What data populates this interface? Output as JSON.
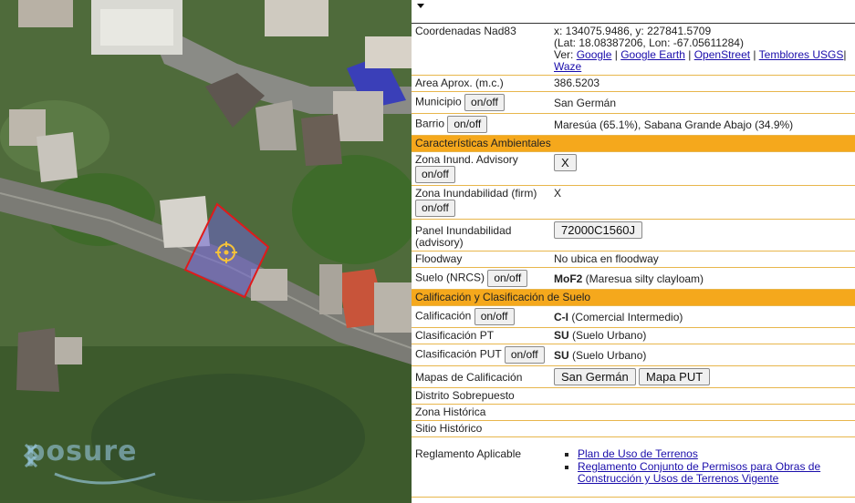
{
  "map": {
    "watermark": "posure"
  },
  "panel": {
    "coords": {
      "label": "Coordenadas Nad83",
      "xy": "x: 134075.9486, y: 227841.5709",
      "latlon": "(Lat: 18.08387206, Lon: -67.05611284)",
      "ver_label": "Ver:",
      "links": [
        "Google",
        "Google Earth",
        "OpenStreet",
        "Temblores USGS",
        "Waze"
      ],
      "sep": " | ",
      "trailing_sep": "|"
    },
    "area": {
      "label": "Area Aprox. (m.c.)",
      "value": "386.5203"
    },
    "municipio": {
      "label": "Municipio",
      "toggle": "on/off",
      "value": "San Germán"
    },
    "barrio": {
      "label": "Barrio",
      "toggle": "on/off",
      "value": "Maresúa (65.1%), Sabana Grande Abajo (34.9%)"
    },
    "section_env": "Características Ambientales",
    "zona_inund_adv": {
      "label": "Zona Inund. Advisory",
      "toggle": "on/off",
      "button": "X"
    },
    "zona_inund_firm": {
      "label": "Zona Inundabilidad (firm)",
      "toggle": "on/off",
      "value": "X"
    },
    "panel_inund": {
      "label": "Panel Inundabilidad (advisory)",
      "button": "72000C1560J"
    },
    "floodway": {
      "label": "Floodway",
      "value": "No ubica en floodway"
    },
    "suelo": {
      "label": "Suelo (NRCS)",
      "toggle": "on/off",
      "value_bold": "MoF2",
      "value_rest": " (Maresua silty clayloam)"
    },
    "section_calif": "Calificación y Clasificación de Suelo",
    "calificacion": {
      "label": "Calificación",
      "toggle": "on/off",
      "value_bold": "C-I",
      "value_rest": " (Comercial Intermedio)"
    },
    "clas_pt": {
      "label": "Clasificación PT",
      "value_bold": "SU",
      "value_rest": " (Suelo Urbano)"
    },
    "clas_put": {
      "label": "Clasificación PUT",
      "toggle": "on/off",
      "value_bold": "SU",
      "value_rest": " (Suelo Urbano)"
    },
    "mapas": {
      "label": "Mapas de Calificación",
      "buttons": [
        "San Germán",
        "Mapa PUT"
      ]
    },
    "distrito": {
      "label": "Distrito Sobrepuesto"
    },
    "zona_hist": {
      "label": "Zona Histórica"
    },
    "sitio_hist": {
      "label": "Sitio Histórico"
    },
    "reglamento": {
      "label": "Reglamento Aplicable",
      "links": [
        "Plan de Uso de Terrenos",
        "Reglamento Conjunto de Permisos para Obras de Construcción y Usos de Terrenos Vigente"
      ]
    }
  },
  "colors": {
    "section_bg": "#f5a81c",
    "row_border": "#e8b64c",
    "link": "#1a0dab",
    "parcel_outline": "#e01a1a"
  }
}
